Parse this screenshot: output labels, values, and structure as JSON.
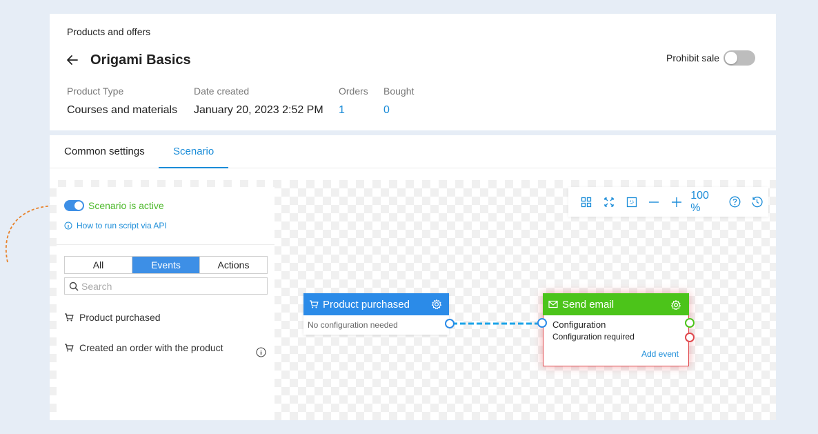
{
  "header": {
    "breadcrumb": "Products and offers",
    "title": "Origami Basics",
    "prohibit_sale_label": "Prohibit sale",
    "meta": [
      {
        "label": "Product Type",
        "value": "Courses and materials"
      },
      {
        "label": "Date created",
        "value": "January 20, 2023 2:52 PM"
      },
      {
        "label": "Orders",
        "value": "1"
      },
      {
        "label": "Bought",
        "value": "0"
      }
    ]
  },
  "tabs": [
    {
      "label": "Common settings",
      "active": false
    },
    {
      "label": "Scenario",
      "active": true
    }
  ],
  "panel": {
    "active_label": "Scenario is active",
    "api_link": "How to run script via API",
    "filters": [
      "All",
      "Events",
      "Actions"
    ],
    "search_placeholder": "Search",
    "events": [
      "Product purchased",
      "Created an order with the product"
    ]
  },
  "zoom": {
    "level": "100 %"
  },
  "nodes": {
    "purchase": {
      "title": "Product purchased",
      "subtitle": "No configuration needed"
    },
    "email": {
      "title": "Send email",
      "line1": "Configuration",
      "line2": "Configuration required",
      "add_event": "Add event"
    }
  },
  "colors": {
    "accent": "#1a8cd8",
    "active_green": "#4cb82a",
    "node_blue": "#2b8be8",
    "node_green": "#4cc41a",
    "error_red": "#e0474c",
    "annotation_orange": "#e8822a"
  }
}
